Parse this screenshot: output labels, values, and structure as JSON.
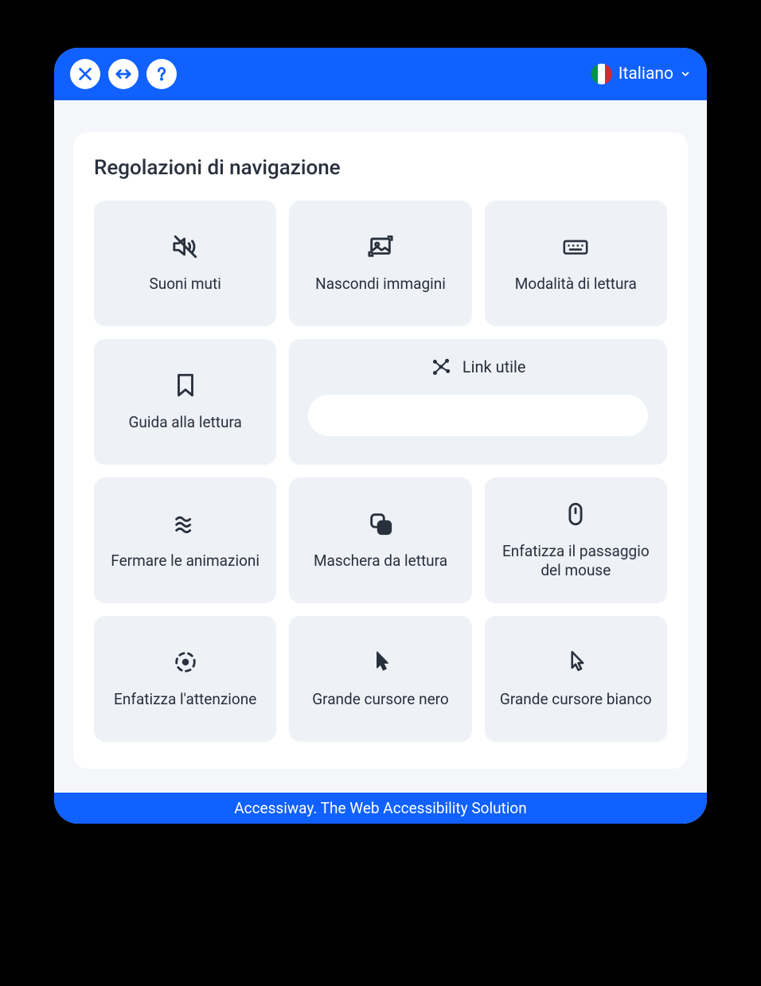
{
  "header": {
    "language_label": "Italiano"
  },
  "section": {
    "title": "Regolazioni di navigazione"
  },
  "tiles": {
    "mute": "Suoni muti",
    "hide_images": "Nascondi immagini",
    "reading_mode": "Modalità di lettura",
    "reading_guide": "Guida alla lettura",
    "useful_links": "Link utile",
    "stop_animations": "Fermare le animazioni",
    "reading_mask": "Maschera da lettura",
    "highlight_hover": "Enfatizza il passaggio del mouse",
    "highlight_focus": "Enfatizza l'attenzione",
    "big_black_cursor": "Grande cursore nero",
    "big_white_cursor": "Grande cursore bianco"
  },
  "footer": {
    "text": "Accessiway. The Web Accessibility Solution"
  }
}
